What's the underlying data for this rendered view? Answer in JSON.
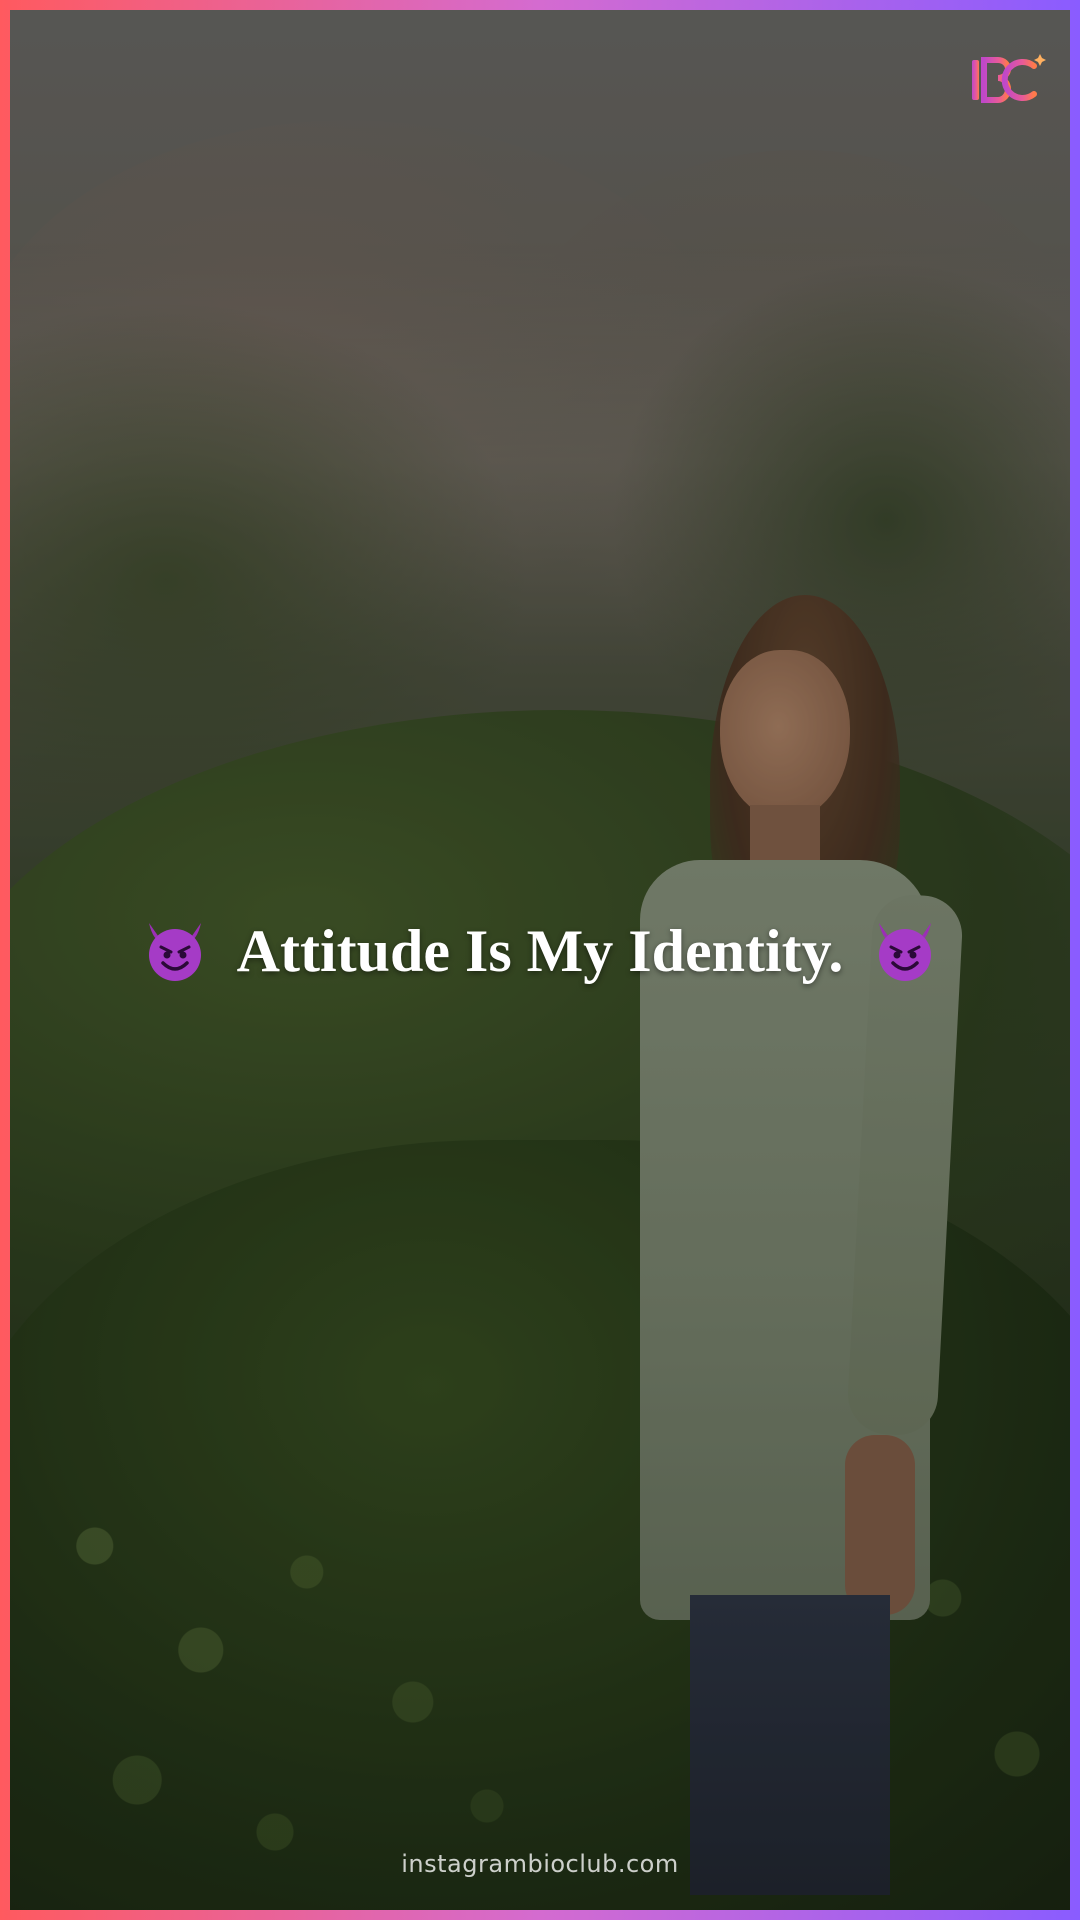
{
  "brand": {
    "logo_text": "IBC",
    "colors": {
      "gradient_start": "#ff5a5f",
      "gradient_mid": "#d46bd0",
      "gradient_end": "#8a5cff"
    }
  },
  "quote": {
    "text": "Attitude Is My Identity.",
    "leading_icon": "smiling-devil-emoji",
    "trailing_icon": "smiling-devil-emoji"
  },
  "footer": {
    "website": "instagrambioclub.com"
  }
}
